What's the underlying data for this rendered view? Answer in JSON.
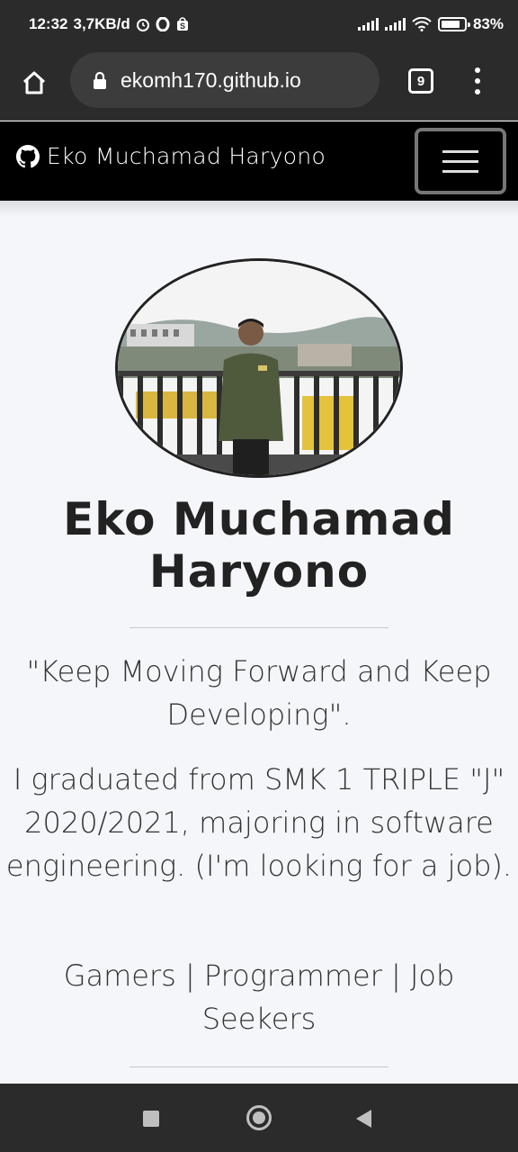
{
  "status_bar": {
    "time": "12:32",
    "net_speed": "3,7KB/d",
    "battery": "83%",
    "battery_level": 0.83
  },
  "browser": {
    "url": "ekomh170.github.io",
    "tab_count": "9"
  },
  "navbar": {
    "brand": "Eko Muchamad Haryono"
  },
  "profile": {
    "name": "Eko Muchamad Haryono",
    "quote": "\"Keep Moving Forward and Keep Developing\".",
    "bio": "I graduated from SMK 1 TRIPLE \"J\" 2020/2021, majoring in software engineering. (I'm looking for a job).",
    "roles": "Gamers | Programmer | Job Seekers"
  },
  "colors": {
    "page_bg": "#f5f6fa",
    "navbar_bg": "#000000",
    "system_bar_bg": "#2b2b2b",
    "text": "#222222"
  }
}
